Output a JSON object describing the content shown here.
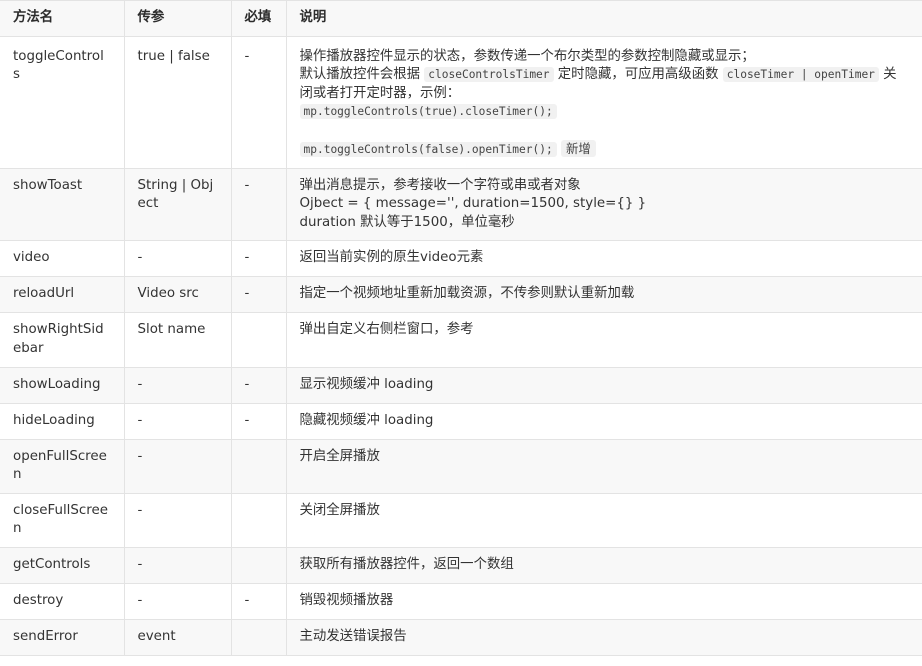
{
  "headers": [
    "方法名",
    "传参",
    "必填",
    "说明"
  ],
  "rows": [
    {
      "method": "toggleControls",
      "param": "true | false",
      "req": "-",
      "desc_line1": "操作播放器控件显示的状态，参数传递一个布尔类型的参数控制隐藏或显示；",
      "desc_pre1": "默认播放控件会根据 ",
      "desc_code1": "closeControlsTimer",
      "desc_mid1": " 定时隐藏，可应用高级函数 ",
      "desc_code2": "closeTimer | openTimer",
      "desc_post1": " 关闭或者打开定时器，示例：",
      "desc_code3": "mp.toggleControls(true).closeTimer();",
      "desc_code4": "mp.toggleControls(false).openTimer();",
      "desc_tag": "新增"
    },
    {
      "method": "showToast",
      "param": "String | Object",
      "req": "-",
      "desc_line1": "弹出消息提示，参考接收一个字符或串或者对象",
      "desc_line2": "Ojbect = { message='', duration=1500, style={} }",
      "desc_line3": "duration 默认等于1500，单位毫秒"
    },
    {
      "method": "video",
      "param": "-",
      "req": "-",
      "desc": "返回当前实例的原生video元素"
    },
    {
      "method": "reloadUrl",
      "param": "Video src",
      "req": "-",
      "desc": "指定一个视频地址重新加载资源，不传参则默认重新加载"
    },
    {
      "method": "showRightSidebar",
      "param": "Slot name",
      "req": "",
      "desc": "弹出自定义右侧栏窗口，参考"
    },
    {
      "method": "showLoading",
      "param": "-",
      "req": "-",
      "desc": "显示视频缓冲 loading"
    },
    {
      "method": "hideLoading",
      "param": "-",
      "req": "-",
      "desc": "隐藏视频缓冲 loading"
    },
    {
      "method": "openFullScreen",
      "param": "-",
      "req": "",
      "desc": "开启全屏播放"
    },
    {
      "method": "closeFullScreen",
      "param": "-",
      "req": "",
      "desc": "关闭全屏播放"
    },
    {
      "method": "getControls",
      "param": "-",
      "req": "",
      "desc": "获取所有播放器控件，返回一个数组"
    },
    {
      "method": "destroy",
      "param": "-",
      "req": "-",
      "desc": "销毁视频播放器"
    },
    {
      "method": "sendError",
      "param": "event",
      "req": "",
      "desc": "主动发送错误报告"
    }
  ]
}
